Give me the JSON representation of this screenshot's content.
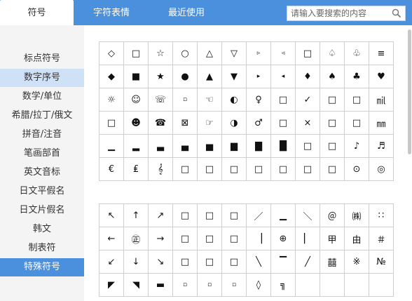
{
  "tabs": [
    {
      "label": "符号"
    },
    {
      "label": "字符表情"
    },
    {
      "label": "最近使用"
    }
  ],
  "search": {
    "placeholder": "请输入要搜索的内容",
    "value": "",
    "icon": "search-icon"
  },
  "sidebar": {
    "items": [
      {
        "label": "标点符号"
      },
      {
        "label": "数字序号"
      },
      {
        "label": "数学/单位"
      },
      {
        "label": "希腊/拉丁/俄文"
      },
      {
        "label": "拼音/注音"
      },
      {
        "label": "笔画部首"
      },
      {
        "label": "英文音标"
      },
      {
        "label": "日文平假名"
      },
      {
        "label": "日文片假名"
      },
      {
        "label": "韩文"
      },
      {
        "label": "制表符"
      },
      {
        "label": "特殊符号"
      }
    ],
    "hovered_index": 1,
    "selected_index": 11
  },
  "colors": {
    "accent": "#4a90dd",
    "hover": "#cfe1f7",
    "sidebar_bg": "#f4f4f4",
    "grid_line": "#cfcfcf"
  },
  "symbol_grids": [
    {
      "rows": [
        [
          "◇",
          "□",
          "☆",
          "○",
          "△",
          "▽",
          "▹",
          "◃",
          "□",
          "♤",
          "♧",
          "≡"
        ],
        [
          "◆",
          "■",
          "★",
          "●",
          "▲",
          "▼",
          "▸",
          "◂",
          "♦",
          "♠",
          "♣",
          "♥"
        ],
        [
          "☼",
          "☺",
          "☏",
          "▫",
          "☜",
          "◐",
          "♀",
          "□",
          "✓",
          "□",
          "□",
          "㏕"
        ],
        [
          "□",
          "☻",
          "☎",
          "⊠",
          "☞",
          "◑",
          "♂",
          "□",
          "×",
          "□",
          "□",
          "㎜"
        ],
        [
          "▁",
          "▂",
          "▃",
          "▄",
          "▅",
          "▆",
          "▇",
          "█",
          "□",
          "□",
          "♪",
          "♬"
        ],
        [
          "€",
          "₤",
          "𝄞",
          "□",
          "□",
          "□",
          "□",
          "□",
          "□",
          "□",
          "⊙",
          "◎"
        ]
      ]
    },
    {
      "rows": [
        [
          "↖",
          "↑",
          "↗",
          "□",
          "□",
          "□",
          "／",
          "▁",
          "＼",
          "＠",
          "㈱",
          "∷"
        ],
        [
          "←",
          "㊣",
          "→",
          "□",
          "□",
          "□",
          "▕",
          "⊕",
          "▏",
          "甲",
          "由",
          "＃"
        ],
        [
          "↙",
          "↓",
          "↘",
          "□",
          "□",
          "□",
          "╲",
          "▔",
          "╱",
          "囍",
          "※",
          "№"
        ],
        [
          "◤",
          "◥",
          "▬",
          "▫",
          "▫",
          "▫",
          "◊",
          "╗",
          "",
          "",
          "",
          ""
        ]
      ]
    }
  ]
}
